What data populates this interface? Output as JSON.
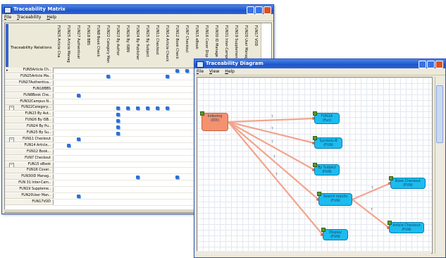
{
  "matrix_window": {
    "title": "Traceability Matrix",
    "menu": [
      "File",
      "Traceability",
      "Help"
    ],
    "corner_label": "Traceability Relations",
    "columns": [
      "FUN25 Article Cha",
      "FUN25 Article Manag",
      "FUN27 Authenticat",
      "FUN18 BBS",
      "FUN8 Book Check",
      "FUN22 Category Man",
      "FUN23 By Author",
      "FUN26 By ISBN",
      "FUN24 By Publisher",
      "FUN25 By Subject",
      "FUN11 Checkout",
      "FUN14 Article Check",
      "FUN12 Book Check",
      "FUN7 Checkout",
      "FUN15 eBook",
      "FUN16 Cover Disp",
      "FUN30 ID Manage",
      "FUN31 Inter-Campus",
      "FUN19 Supplement",
      "FUN20 User Manag",
      "FUN17 VOD"
    ],
    "rows": [
      {
        "label": "FUN5Article Ch..",
        "indent": 0,
        "toggle": "",
        "pointer": "▸"
      },
      {
        "label": "FUN25Article Ma..",
        "indent": 0,
        "toggle": "",
        "pointer": ""
      },
      {
        "label": "FUN27Authentica..",
        "indent": 0,
        "toggle": "",
        "pointer": ""
      },
      {
        "label": "FUN18BBS",
        "indent": 0,
        "toggle": "",
        "pointer": ""
      },
      {
        "label": "FUN8Book Che..",
        "indent": 0,
        "toggle": "",
        "pointer": ""
      },
      {
        "label": "FUN32Campus N..",
        "indent": 0,
        "toggle": "",
        "pointer": ""
      },
      {
        "label": "FUN22Category...",
        "indent": 0,
        "toggle": "−",
        "pointer": ""
      },
      {
        "label": "FUN23 By Aut..",
        "indent": 1,
        "toggle": "",
        "pointer": ""
      },
      {
        "label": "FUN26 By ISB..",
        "indent": 1,
        "toggle": "",
        "pointer": ""
      },
      {
        "label": "FUN24 By Pu..",
        "indent": 1,
        "toggle": "",
        "pointer": ""
      },
      {
        "label": "FUN25 By Su..",
        "indent": 1,
        "toggle": "",
        "pointer": ""
      },
      {
        "label": "FUN11 Checkout",
        "indent": 0,
        "toggle": "−",
        "pointer": ""
      },
      {
        "label": "FUN14 Article...",
        "indent": 1,
        "toggle": "",
        "pointer": ""
      },
      {
        "label": "FUN12 Book...",
        "indent": 1,
        "toggle": "",
        "pointer": ""
      },
      {
        "label": "FUN7 Checkout",
        "indent": 0,
        "toggle": "",
        "pointer": ""
      },
      {
        "label": "FUN15 eBook",
        "indent": 0,
        "toggle": "−",
        "pointer": ""
      },
      {
        "label": "FUN16 Cover..",
        "indent": 1,
        "toggle": "",
        "pointer": ""
      },
      {
        "label": "FUN30ID Manag..",
        "indent": 0,
        "toggle": "",
        "pointer": ""
      },
      {
        "label": "FUN 31 Inter-Cam..",
        "indent": 0,
        "toggle": "",
        "pointer": ""
      },
      {
        "label": "FUN19 Suppleme..",
        "indent": 0,
        "toggle": "",
        "pointer": ""
      },
      {
        "label": "FUN20User Man..",
        "indent": 0,
        "toggle": "",
        "pointer": ""
      },
      {
        "label": "FUN17VOD",
        "indent": 0,
        "toggle": "",
        "pointer": ""
      }
    ],
    "marks": [
      [
        0,
        12
      ],
      [
        0,
        13
      ],
      [
        1,
        5
      ],
      [
        1,
        11
      ],
      [
        4,
        2
      ],
      [
        6,
        6
      ],
      [
        6,
        7
      ],
      [
        6,
        8
      ],
      [
        6,
        9
      ],
      [
        6,
        10
      ],
      [
        6,
        11
      ],
      [
        7,
        6
      ],
      [
        8,
        6
      ],
      [
        9,
        6
      ],
      [
        10,
        6
      ],
      [
        11,
        2
      ],
      [
        12,
        1
      ],
      [
        17,
        8
      ],
      [
        17,
        12
      ],
      [
        17,
        14
      ],
      [
        20,
        2
      ]
    ]
  },
  "diagram_window": {
    "title": "Traceability Diagram",
    "menu": [
      "File",
      "View",
      "Help"
    ],
    "nodes": [
      {
        "id": "src",
        "label": "Indexing",
        "sub": "(IDX)",
        "color": "orange"
      },
      {
        "id": "n1",
        "label": "FUN1A",
        "sub": "(Fun)",
        "color": "blue"
      },
      {
        "id": "n2",
        "label": "Symbols-B",
        "sub": "(FUN)",
        "color": "blue"
      },
      {
        "id": "n3",
        "label": "By Subject",
        "sub": "(FUN)",
        "color": "blue"
      },
      {
        "id": "n4",
        "label": "Search results",
        "sub": "(FUN)",
        "color": "blue"
      },
      {
        "id": "n5",
        "label": "Book Checkout",
        "sub": "(FUN)",
        "color": "blue"
      },
      {
        "id": "n6",
        "label": "Article Checkout",
        "sub": "(FUN)",
        "color": "blue"
      },
      {
        "id": "n7",
        "label": "Display",
        "sub": "(FUN)",
        "color": "blue"
      }
    ],
    "edge_label": "?"
  }
}
